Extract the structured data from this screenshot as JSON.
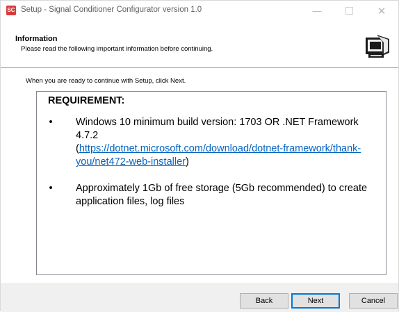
{
  "window": {
    "title": "Setup - Signal Conditioner Configurator version 1.0",
    "app_icon_text": "SC",
    "min_glyph": "—",
    "close_glyph": "✕"
  },
  "header": {
    "title": "Information",
    "subtitle": "Please read the following important information before continuing."
  },
  "intro": "When you are ready to continue with Setup, click Next.",
  "info": {
    "heading": "REQUIREMENT:",
    "bullet_glyph": "•",
    "item1_text": "Windows 10 minimum build version: 1703 OR .NET Framework 4.7.2",
    "item1_open": "(",
    "item1_link": "https://dotnet.microsoft.com/download/dotnet-framework/thank-you/net472-web-installer",
    "item1_close": ")",
    "item2_text": "Approximately 1Gb of free storage (5Gb recommended) to create application files, log files"
  },
  "buttons": {
    "back": "Back",
    "next": "Next",
    "cancel": "Cancel"
  },
  "colors": {
    "link": "#0563c1",
    "focus_border": "#0078d7",
    "app_icon": "#d83b3b"
  }
}
